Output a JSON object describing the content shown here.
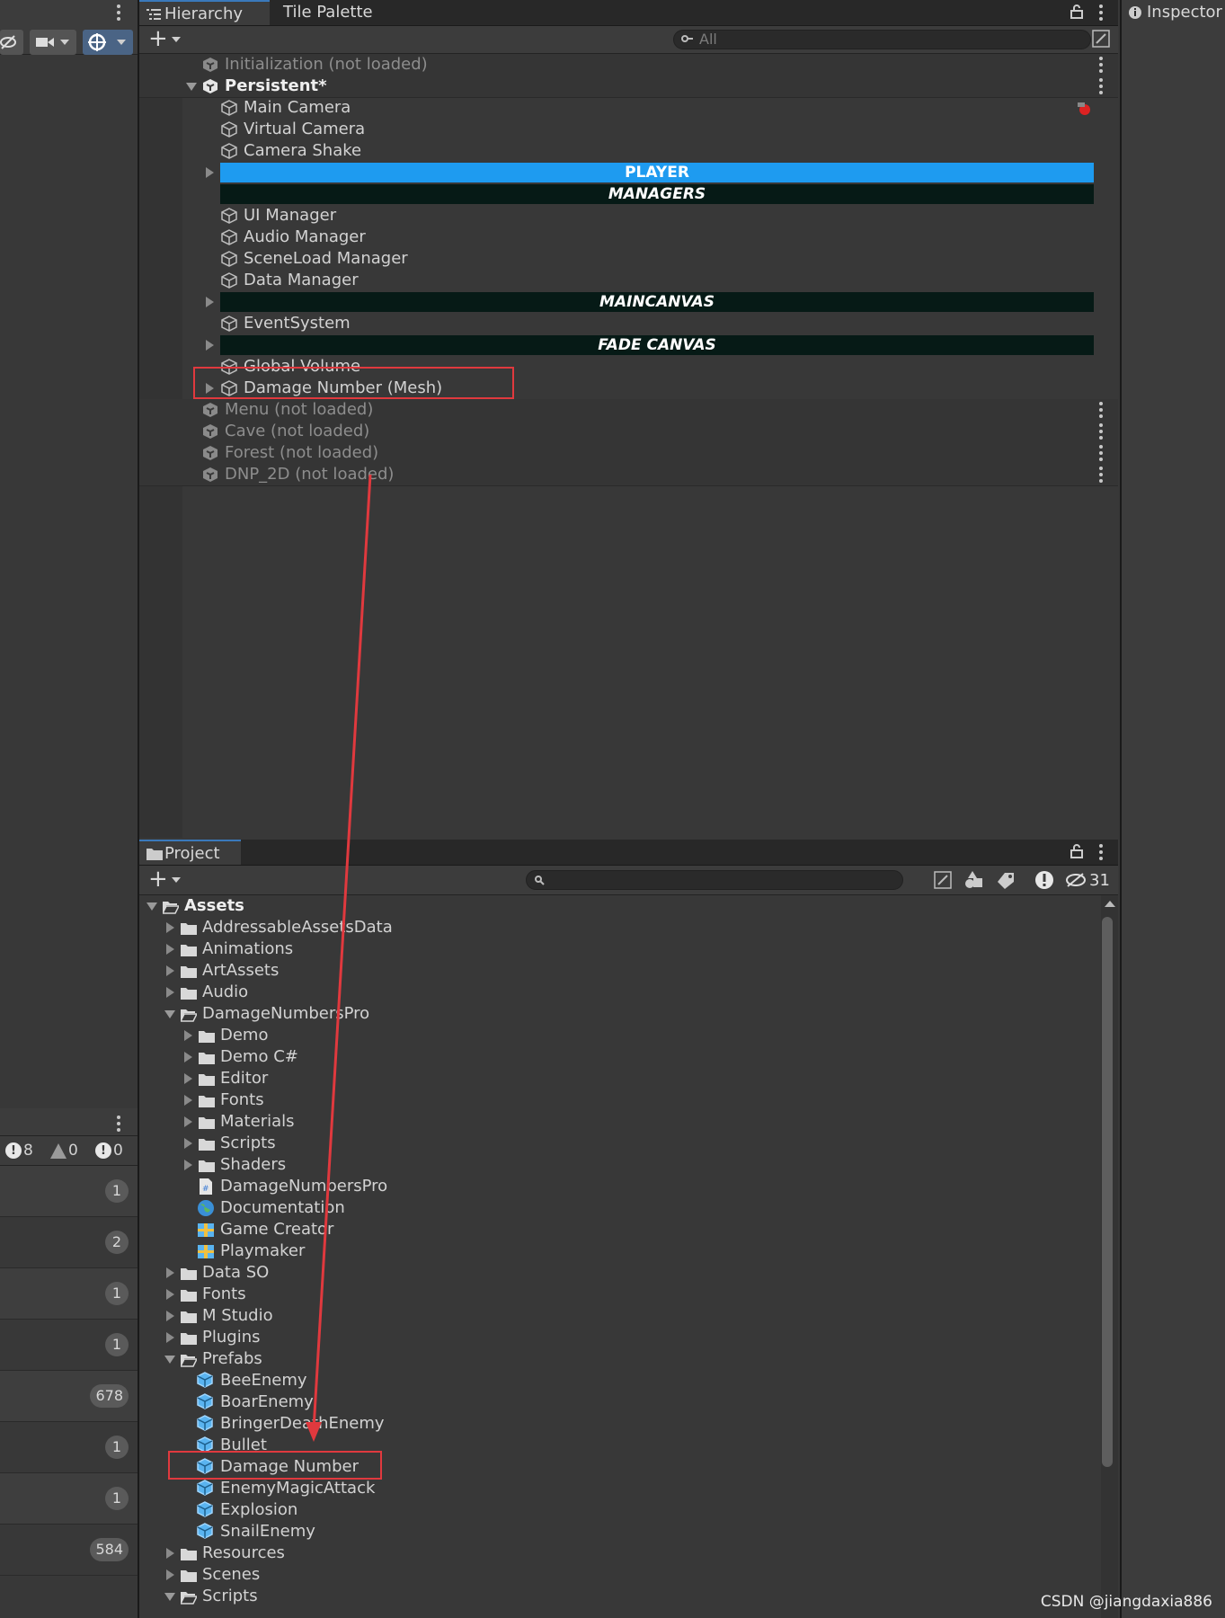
{
  "left": {
    "console_counts": {
      "errors": "8",
      "warnings": "0",
      "infos": "0"
    },
    "log_badges": [
      "1",
      "2",
      "1",
      "1",
      "678",
      "1",
      "1",
      "584"
    ]
  },
  "hierarchy": {
    "tabs": [
      "Hierarchy",
      "Tile Palette"
    ],
    "search_placeholder": "All",
    "rows": [
      {
        "type": "scene",
        "label": "Initialization (not loaded)",
        "loaded": false
      },
      {
        "type": "scene",
        "label": "Persistent*",
        "loaded": true,
        "expanded": true
      },
      {
        "type": "object",
        "label": "Main Camera",
        "has_badge": true
      },
      {
        "type": "object",
        "label": "Virtual Camera"
      },
      {
        "type": "object",
        "label": "Camera Shake"
      },
      {
        "type": "header",
        "label": "PLAYER",
        "style": "blue",
        "expandable": true
      },
      {
        "type": "header",
        "label": "MANAGERS",
        "style": "dark"
      },
      {
        "type": "object",
        "label": "UI Manager"
      },
      {
        "type": "object",
        "label": "Audio Manager"
      },
      {
        "type": "object",
        "label": "SceneLoad Manager"
      },
      {
        "type": "object",
        "label": "Data Manager"
      },
      {
        "type": "header",
        "label": "MAINCANVAS",
        "style": "dark",
        "expandable": true
      },
      {
        "type": "object",
        "label": "EventSystem"
      },
      {
        "type": "header",
        "label": "FADE CANVAS",
        "style": "dark",
        "expandable": true
      },
      {
        "type": "object",
        "label": "Global Volume"
      },
      {
        "type": "object",
        "label": "Damage Number (Mesh)",
        "expandable": true,
        "highlighted": true
      },
      {
        "type": "scene",
        "label": "Menu (not loaded)",
        "loaded": false
      },
      {
        "type": "scene",
        "label": "Cave (not loaded)",
        "loaded": false
      },
      {
        "type": "scene",
        "label": "Forest (not loaded)",
        "loaded": false
      },
      {
        "type": "scene",
        "label": "DNP_2D (not loaded)",
        "loaded": false
      }
    ]
  },
  "project": {
    "tab": "Project",
    "hidden_count": "31",
    "tree": [
      {
        "label": "Assets",
        "depth": 0,
        "kind": "folder",
        "open": true,
        "bold": true
      },
      {
        "label": "AddressableAssetsData",
        "depth": 1,
        "kind": "folder"
      },
      {
        "label": "Animations",
        "depth": 1,
        "kind": "folder"
      },
      {
        "label": "ArtAssets",
        "depth": 1,
        "kind": "folder"
      },
      {
        "label": "Audio",
        "depth": 1,
        "kind": "folder"
      },
      {
        "label": "DamageNumbersPro",
        "depth": 1,
        "kind": "folder",
        "open": true
      },
      {
        "label": "Demo",
        "depth": 2,
        "kind": "folder"
      },
      {
        "label": "Demo C#",
        "depth": 2,
        "kind": "folder"
      },
      {
        "label": "Editor",
        "depth": 2,
        "kind": "folder"
      },
      {
        "label": "Fonts",
        "depth": 2,
        "kind": "folder"
      },
      {
        "label": "Materials",
        "depth": 2,
        "kind": "folder"
      },
      {
        "label": "Scripts",
        "depth": 2,
        "kind": "folder"
      },
      {
        "label": "Shaders",
        "depth": 2,
        "kind": "folder"
      },
      {
        "label": "DamageNumbersPro",
        "depth": 2,
        "kind": "script"
      },
      {
        "label": "Documentation",
        "depth": 2,
        "kind": "web"
      },
      {
        "label": "Game Creator",
        "depth": 2,
        "kind": "package"
      },
      {
        "label": "Playmaker",
        "depth": 2,
        "kind": "package"
      },
      {
        "label": "Data SO",
        "depth": 1,
        "kind": "folder"
      },
      {
        "label": "Fonts",
        "depth": 1,
        "kind": "folder"
      },
      {
        "label": "M Studio",
        "depth": 1,
        "kind": "folder"
      },
      {
        "label": "Plugins",
        "depth": 1,
        "kind": "folder"
      },
      {
        "label": "Prefabs",
        "depth": 1,
        "kind": "folder",
        "open": true
      },
      {
        "label": "BeeEnemy",
        "depth": 2,
        "kind": "prefab"
      },
      {
        "label": "BoarEnemy",
        "depth": 2,
        "kind": "prefab"
      },
      {
        "label": "BringerDeathEnemy",
        "depth": 2,
        "kind": "prefab"
      },
      {
        "label": "Bullet",
        "depth": 2,
        "kind": "prefab"
      },
      {
        "label": "Damage Number",
        "depth": 2,
        "kind": "prefab",
        "highlighted": true
      },
      {
        "label": "EnemyMagicAttack",
        "depth": 2,
        "kind": "prefab"
      },
      {
        "label": "Explosion",
        "depth": 2,
        "kind": "prefab"
      },
      {
        "label": "SnailEnemy",
        "depth": 2,
        "kind": "prefab"
      },
      {
        "label": "Resources",
        "depth": 1,
        "kind": "folder"
      },
      {
        "label": "Scenes",
        "depth": 1,
        "kind": "folder"
      },
      {
        "label": "Scripts",
        "depth": 1,
        "kind": "folder",
        "open": true
      }
    ]
  },
  "inspector": {
    "tab": "Inspector"
  },
  "watermark": "CSDN @jiangdaxia886",
  "colors": {
    "accent_blue": "#1e9bf0",
    "header_dark": "#061a16",
    "highlight_red": "#e0393e",
    "prefab_blue": "#5ab4f0"
  }
}
